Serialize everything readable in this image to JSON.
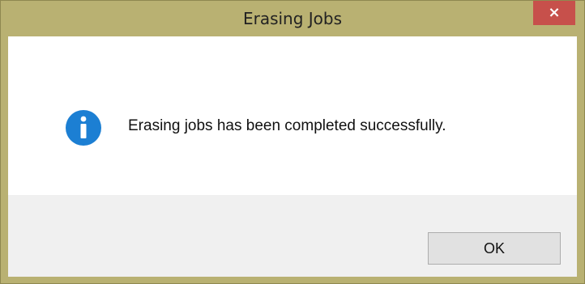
{
  "dialog": {
    "title": "Erasing Jobs",
    "close_label": "×",
    "message": "Erasing jobs has been completed successfully.",
    "icon": "info-icon",
    "ok_label": "OK"
  },
  "colors": {
    "frame": "#b9b172",
    "close_button": "#c7504b",
    "info_icon": "#1c7fd3",
    "footer": "#f0f0f0"
  }
}
